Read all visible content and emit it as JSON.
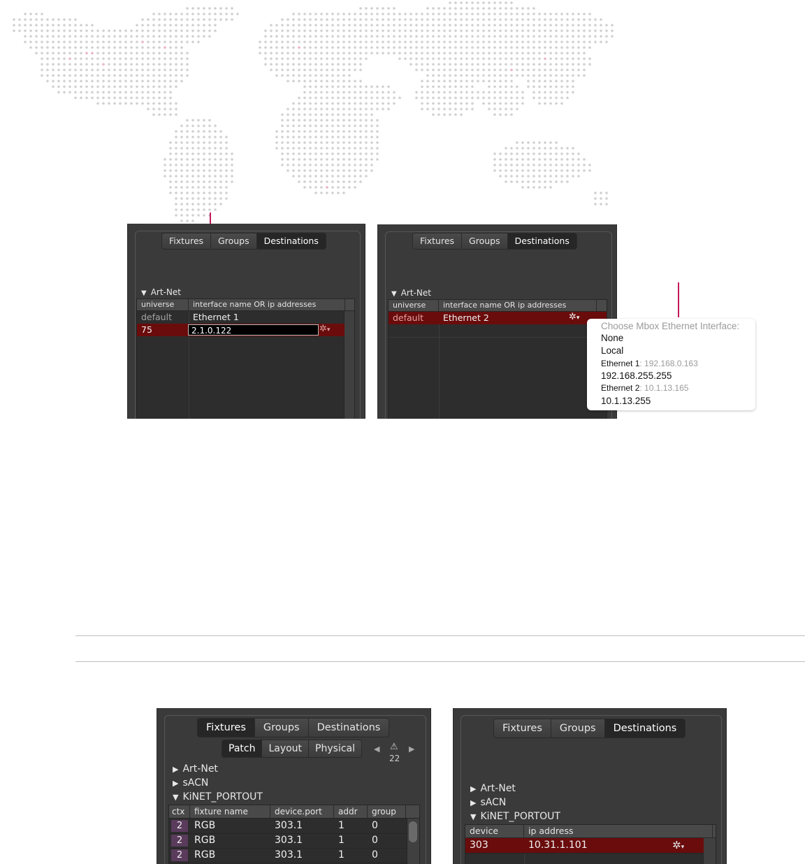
{
  "colors": {
    "accent": "#c2185b",
    "selected_row": "#6a0c0c",
    "panel_bg": "#3a3a3a",
    "map_dot": "#d0d0d0",
    "map_dot_accent": "#e8b4c2"
  },
  "panel_a": {
    "tabs": [
      "Fixtures",
      "Groups",
      "Destinations"
    ],
    "active_tab": "Destinations",
    "section": "Art-Net",
    "columns": [
      "universe",
      "interface name OR ip addresses"
    ],
    "rows": [
      {
        "universe": "default",
        "iface": "Ethernet 1"
      },
      {
        "universe": "75",
        "iface": "2.1.0.122"
      }
    ],
    "gear_icon": "gear-icon"
  },
  "panel_b": {
    "tabs": [
      "Fixtures",
      "Groups",
      "Destinations"
    ],
    "active_tab": "Destinations",
    "section": "Art-Net",
    "columns": [
      "universe",
      "interface name OR ip addresses"
    ],
    "rows": [
      {
        "universe": "default",
        "iface": "Ethernet 2"
      }
    ]
  },
  "popup": {
    "title": "Choose Mbox Ethernet Interface:",
    "items": {
      "none": "None",
      "local": "Local",
      "eth1_label": "Ethernet 1",
      "eth1_ip": ": 192.168.0.163",
      "eth1_bcast": "192.168.255.255",
      "eth2_label": "Ethernet 2",
      "eth2_ip": ": 10.1.13.165",
      "eth2_bcast": "10.1.13.255"
    }
  },
  "panel_c": {
    "tabs": [
      "Fixtures",
      "Groups",
      "Destinations"
    ],
    "active_tab": "Fixtures",
    "subtabs": [
      "Patch",
      "Layout",
      "Physical"
    ],
    "active_subtab": "Patch",
    "warning_count": "22",
    "sections": [
      "Art-Net",
      "sACN",
      "KiNET_PORTOUT"
    ],
    "columns": [
      "ctx",
      "fixture name",
      "device.port",
      "addr",
      "group"
    ],
    "rows": [
      {
        "ctx": "2",
        "name": "RGB",
        "port": "303.1",
        "addr": "1",
        "group": "0"
      },
      {
        "ctx": "2",
        "name": "RGB",
        "port": "303.1",
        "addr": "1",
        "group": "0"
      },
      {
        "ctx": "2",
        "name": "RGB",
        "port": "303.1",
        "addr": "1",
        "group": "0"
      }
    ]
  },
  "panel_d": {
    "tabs": [
      "Fixtures",
      "Groups",
      "Destinations"
    ],
    "active_tab": "Destinations",
    "sections": [
      "Art-Net",
      "sACN",
      "KiNET_PORTOUT"
    ],
    "columns": [
      "device",
      "ip address"
    ],
    "rows": [
      {
        "device": "303",
        "ip": "10.31.1.101"
      }
    ]
  }
}
